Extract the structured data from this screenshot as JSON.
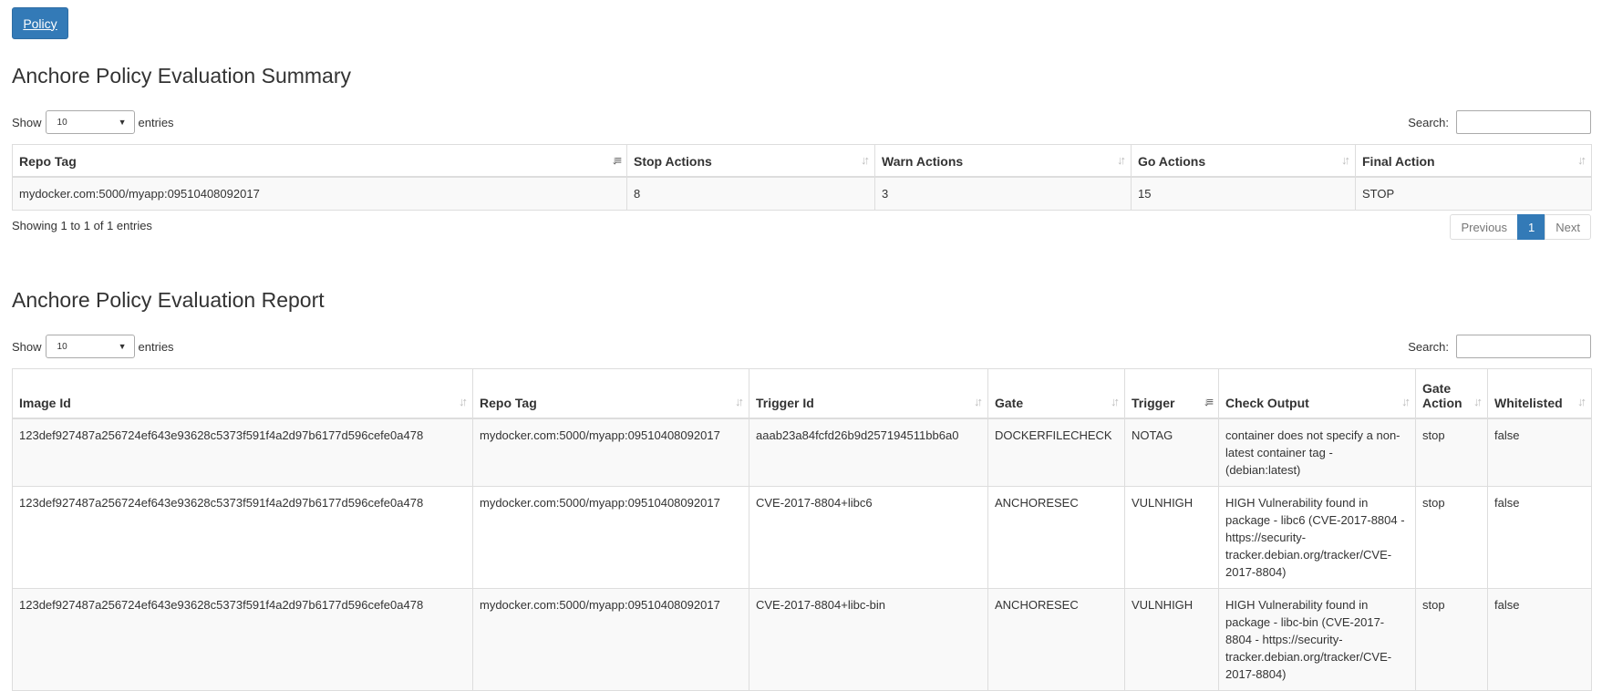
{
  "policy_button": "Policy",
  "summary": {
    "title": "Anchore Policy Evaluation Summary",
    "show_label": "Show",
    "entries_label": "entries",
    "page_length": "10",
    "search_label": "Search:",
    "columns": [
      "Repo Tag",
      "Stop Actions",
      "Warn Actions",
      "Go Actions",
      "Final Action"
    ],
    "rows": [
      [
        "mydocker.com:5000/myapp:09510408092017",
        "8",
        "3",
        "15",
        "STOP"
      ]
    ],
    "info": "Showing 1 to 1 of 1 entries",
    "pagination": {
      "previous": "Previous",
      "current": "1",
      "next": "Next"
    }
  },
  "report": {
    "title": "Anchore Policy Evaluation Report",
    "show_label": "Show",
    "entries_label": "entries",
    "page_length": "10",
    "search_label": "Search:",
    "columns": [
      "Image Id",
      "Repo Tag",
      "Trigger Id",
      "Gate",
      "Trigger",
      "Check Output",
      "Gate Action",
      "Whitelisted"
    ],
    "rows": [
      [
        "123def927487a256724ef643e93628c5373f591f4a2d97b6177d596cefe0a478",
        "mydocker.com:5000/myapp:09510408092017",
        "aaab23a84fcfd26b9d257194511bb6a0",
        "DOCKERFILECHECK",
        "NOTAG",
        "container does not specify a non-latest container tag - (debian:latest)",
        "stop",
        "false"
      ],
      [
        "123def927487a256724ef643e93628c5373f591f4a2d97b6177d596cefe0a478",
        "mydocker.com:5000/myapp:09510408092017",
        "CVE-2017-8804+libc6",
        "ANCHORESEC",
        "VULNHIGH",
        "HIGH Vulnerability found in package - libc6 (CVE-2017-8804 - https://security-tracker.debian.org/tracker/CVE-2017-8804)",
        "stop",
        "false"
      ],
      [
        "123def927487a256724ef643e93628c5373f591f4a2d97b6177d596cefe0a478",
        "mydocker.com:5000/myapp:09510408092017",
        "CVE-2017-8804+libc-bin",
        "ANCHORESEC",
        "VULNHIGH",
        "HIGH Vulnerability found in package - libc-bin (CVE-2017-8804 - https://security-tracker.debian.org/tracker/CVE-2017-8804)",
        "stop",
        "false"
      ]
    ]
  }
}
